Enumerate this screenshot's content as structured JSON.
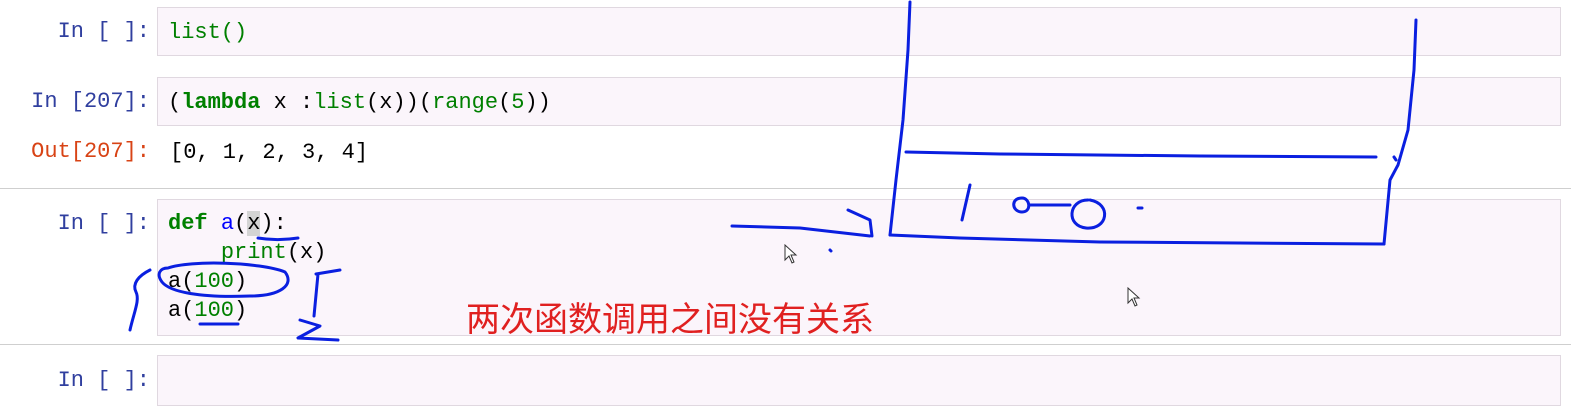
{
  "cells": [
    {
      "prompt": "In [ ]:",
      "code": [
        "list()"
      ]
    },
    {
      "prompt": "In [207]:",
      "code": [
        "(lambda x :list(x))(range(5))"
      ],
      "out_prompt": "Out[207]:",
      "output": "[0, 1, 2, 3, 4]"
    },
    {
      "prompt": "In [ ]:",
      "code": [
        "def a(x):",
        "    print(x)",
        "a(100)",
        "a(100)"
      ]
    },
    {
      "prompt": "In [ ]:",
      "code": []
    }
  ],
  "annotation": {
    "text": "两次函数调用之间没有关系",
    "color": "#e02020"
  },
  "drawing": {
    "handwritten_text": "1 0 0",
    "ink_color": "#0a1fe0"
  },
  "colors": {
    "in_prompt": "#303f9f",
    "out_prompt": "#d84315",
    "keyword": "#008000",
    "function_name": "#0000ff",
    "cell_background": "#fbf5fb"
  }
}
